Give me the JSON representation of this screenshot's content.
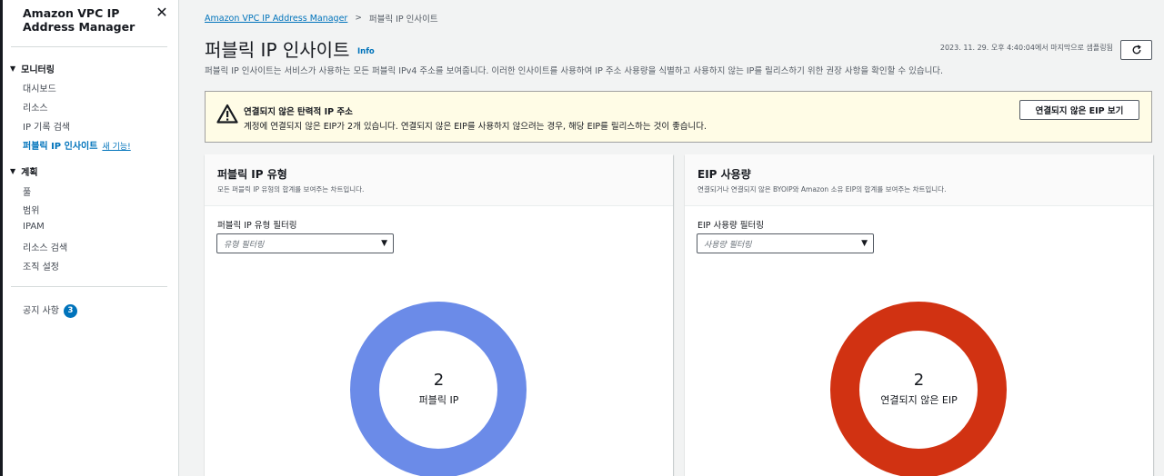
{
  "sidebar": {
    "title": "Amazon VPC IP Address Manager",
    "sections": [
      {
        "label": "모니터링",
        "items": [
          "대시보드",
          "리소스",
          "IP 기록 검색"
        ],
        "active": "퍼블릭 IP 인사이트",
        "new_label": "새 기능!"
      },
      {
        "label": "계획",
        "items": [
          "풀",
          "범위",
          "IPAM",
          "리소스 검색",
          "조직 설정"
        ]
      }
    ],
    "notices": {
      "label": "공지 사항",
      "count": "3"
    }
  },
  "breadcrumb": {
    "root": "Amazon VPC IP Address Manager",
    "current": "퍼블릭 IP 인사이트"
  },
  "header": {
    "title": "퍼블릭 IP 인사이트",
    "info": "Info",
    "refresh_time": "2023. 11. 29. 오후 4:40:04에서 마지막으로 샘플링됨",
    "description": "퍼블릭 IP 인사이트는 서비스가 사용하는 모든 퍼블릭 IPv4 주소를 보여줍니다. 이러한 인사이트를 사용하여 IP 주소 사용량을 식별하고 사용하지 않는 IP를 릴리스하기 위한 권장 사항을 확인할 수 있습니다."
  },
  "alert": {
    "title": "연결되지 않은 탄력적 IP 주소",
    "text": "계정에 연결되지 않은 EIP가 2개 있습니다. 연결되지 않은 EIP를 사용하지 않으려는 경우, 해당 EIP를 릴리스하는 것이 좋습니다.",
    "button": "연결되지 않은 EIP 보기"
  },
  "cards": [
    {
      "title": "퍼블릭 IP 유형",
      "subtitle": "모든 퍼블릭 IP 유형의 합계를 보여주는 차트입니다.",
      "filter_label": "퍼블릭 IP 유형 필터링",
      "filter_placeholder": "유형 필터링",
      "donut_value": "2",
      "donut_label": "퍼블릭 IP",
      "color": "#6b8be8"
    },
    {
      "title": "EIP 사용량",
      "subtitle": "연결되거나 연결되지 않은 BYOIP와 Amazon 소유 EIP의 합계를 보여주는 차트입니다.",
      "filter_label": "EIP 사용량 필터링",
      "filter_placeholder": "사용량 필터링",
      "donut_value": "2",
      "donut_label": "연결되지 않은 EIP",
      "color": "#d13212"
    }
  ]
}
